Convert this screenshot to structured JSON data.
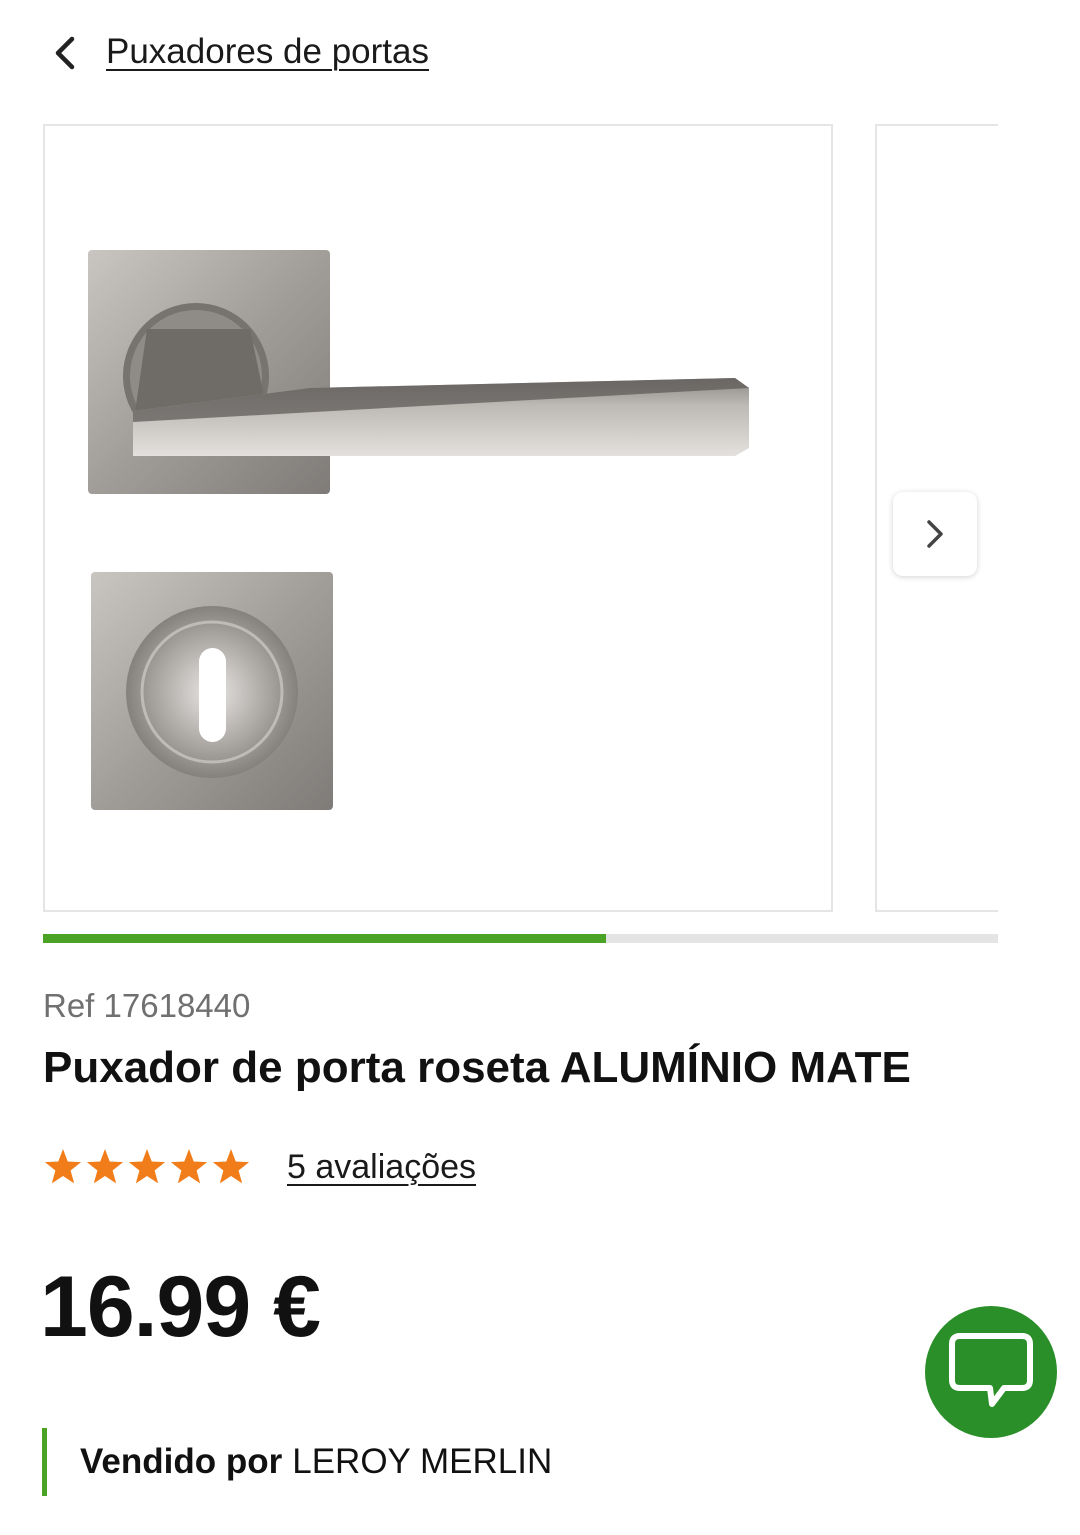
{
  "header": {
    "breadcrumb": "Puxadores de portas"
  },
  "gallery": {
    "progress_fraction": 0.59
  },
  "product": {
    "ref_label": "Ref",
    "ref_number": "17618440",
    "title": "Puxador de porta roseta ALUMÍNIO MATE",
    "rating_value": 5,
    "rating_max": 5,
    "reviews_label": "5 avaliações",
    "price": "16.99 €"
  },
  "seller": {
    "label": "Vendido por",
    "name": "LEROY MERLIN"
  },
  "colors": {
    "brand_green": "#4aa324",
    "chat_green": "#2a8f28",
    "star_orange": "#f07d19"
  },
  "icons": {
    "back": "chevron-left-icon",
    "next": "chevron-right-icon",
    "chat": "chat-bubble-icon",
    "star": "star-icon"
  }
}
